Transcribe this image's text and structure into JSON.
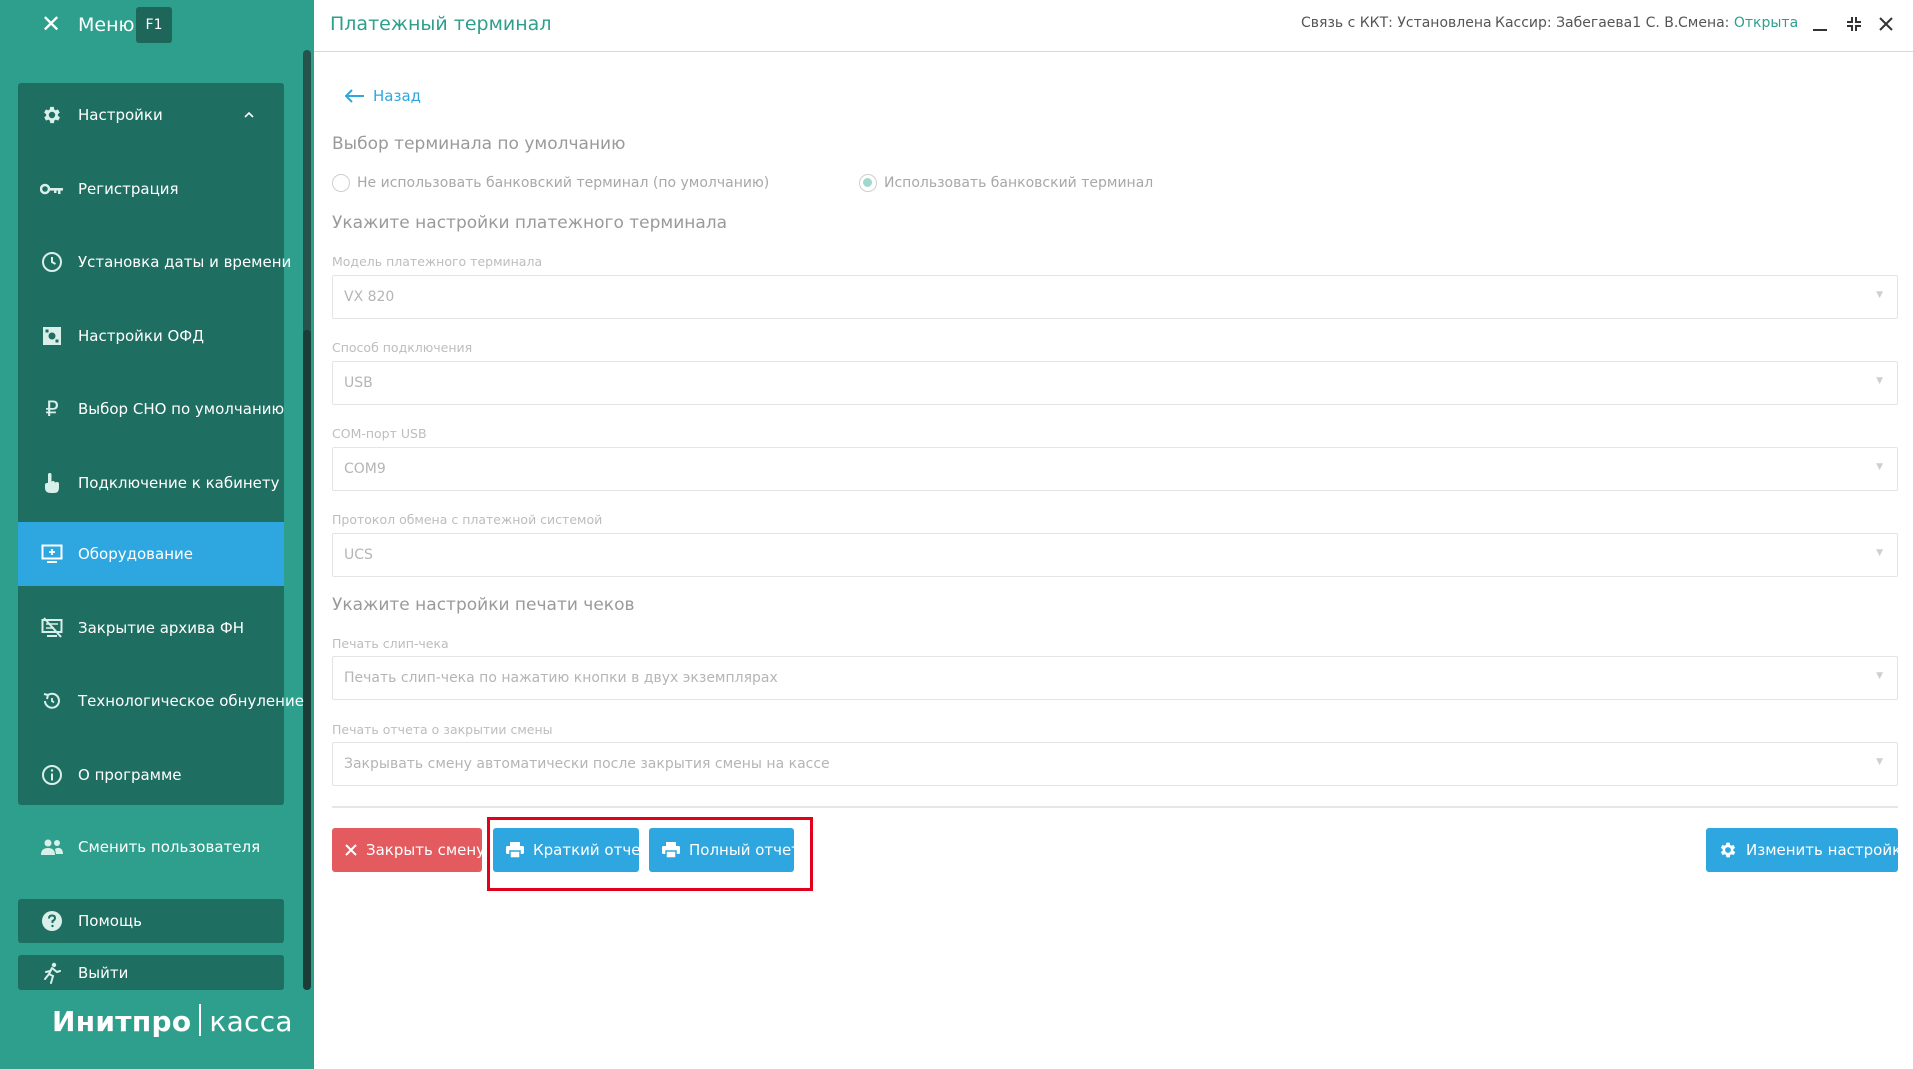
{
  "sidebar": {
    "menu_label": "Меню",
    "f1_badge": "F1",
    "items": [
      {
        "label": "Настройки",
        "icon": "gear-icon"
      },
      {
        "label": "Регистрация",
        "icon": "key-icon"
      },
      {
        "label": "Установка даты и времени",
        "icon": "clock-icon"
      },
      {
        "label": "Настройки ОФД",
        "icon": "ofd-icon"
      },
      {
        "label": "Выбор СНО по умолчанию",
        "icon": "ruble-icon"
      },
      {
        "label": "Подключение к кабинету",
        "icon": "hand-pointer-icon"
      },
      {
        "label": "Оборудование",
        "icon": "monitor-icon"
      },
      {
        "label": "Закрытие архива ФН",
        "icon": "archive-close-icon"
      },
      {
        "label": "Технологическое обнуление",
        "icon": "reset-icon"
      },
      {
        "label": "О программе",
        "icon": "info-icon"
      }
    ],
    "switch_user": "Сменить пользователя",
    "help": "Помощь",
    "logout": "Выйти",
    "logo_brand": "Инитпро",
    "logo_product": "касса"
  },
  "header": {
    "title": "Платежный терминал",
    "kkt_status": "Связь с ККТ: Установлена",
    "cashier": "Кассир: Забегаева1 С. В.",
    "shift_label": "Смена:",
    "shift_value": "Открыта",
    "shift_color": "#2e9f8c"
  },
  "content": {
    "back_label": "Назад",
    "section_default_terminal": "Выбор терминала по умолчанию",
    "radio_no_terminal": "Не использовать банковский терминал (по умолчанию)",
    "radio_use_terminal": "Использовать банковский терминал",
    "radio_selected": "use_terminal",
    "section_terminal_settings": "Укажите настройки платежного терминала",
    "fields": [
      {
        "label": "Модель платежного терминала",
        "value": "VX 820"
      },
      {
        "label": "Способ подключения",
        "value": "USB"
      },
      {
        "label": "COM-порт USB",
        "value": "COM9"
      },
      {
        "label": "Протокол обмена с платежной системой",
        "value": "UCS"
      }
    ],
    "section_print_settings": "Укажите настройки печати чеков",
    "print_fields": [
      {
        "label": "Печать слип-чека",
        "value": "Печать слип-чека по нажатию кнопки в двух экземплярах"
      },
      {
        "label": "Печать отчета о закрытии смены",
        "value": "Закрывать смену автоматически после закрытия смены на кассе"
      }
    ]
  },
  "actions": {
    "close_shift": "Закрыть смену",
    "short_report": "Краткий отчет",
    "full_report": "Полный отчет",
    "change_settings": "Изменить настройки"
  },
  "colors": {
    "sidebar": "#2e9f8c",
    "sidebar_group": "#1e6e61",
    "active": "#2ea7e0",
    "danger": "#e35b5f",
    "highlight": "#e3001b"
  }
}
